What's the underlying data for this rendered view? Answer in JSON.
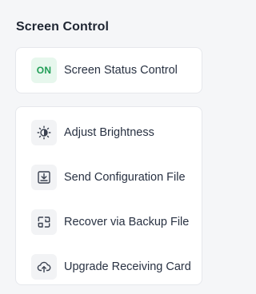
{
  "section": {
    "title": "Screen Control"
  },
  "status_card": {
    "badge": "ON",
    "label": "Screen Status Control"
  },
  "actions": [
    {
      "icon": "brightness-icon",
      "label": "Adjust Brightness"
    },
    {
      "icon": "download-tray-icon",
      "label": "Send Configuration File"
    },
    {
      "icon": "backup-restore-icon",
      "label": "Recover via Backup File"
    },
    {
      "icon": "cloud-upload-icon",
      "label": "Upgrade Receiving Card"
    }
  ],
  "colors": {
    "background": "#f5f6f8",
    "card": "#ffffff",
    "on_badge_bg": "#e7f7ed",
    "on_badge_text": "#1f9d55",
    "icon_bg": "#f2f3f5"
  }
}
